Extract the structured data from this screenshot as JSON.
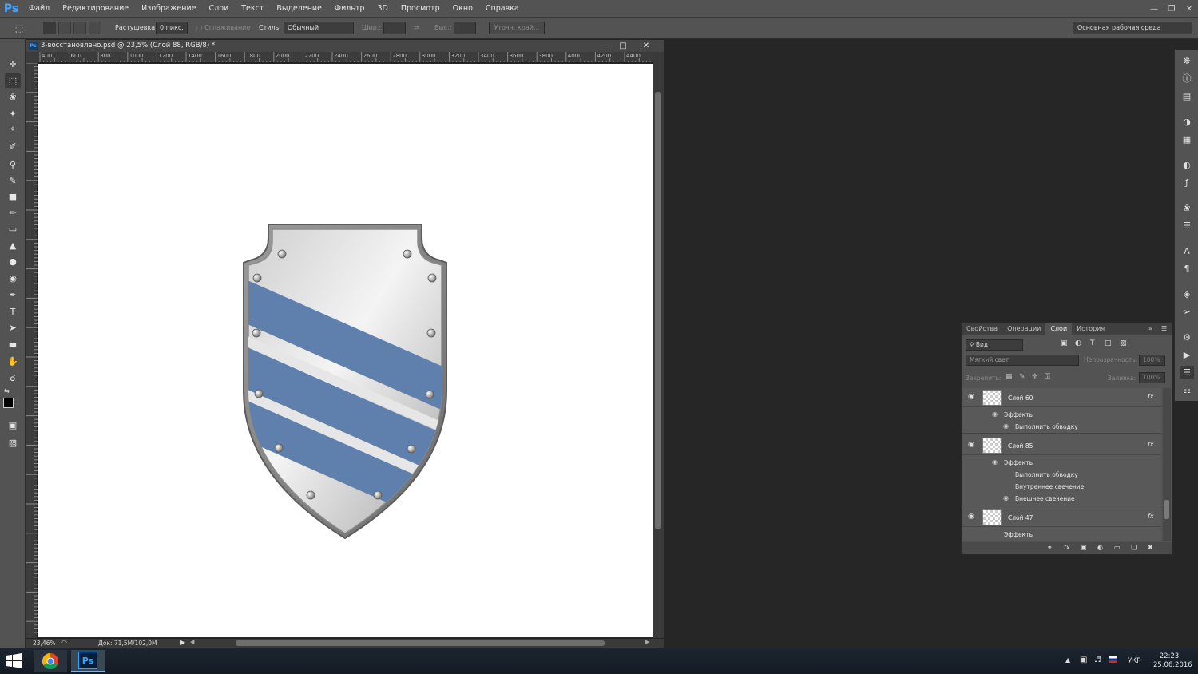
{
  "app": {
    "logo": "Ps"
  },
  "menu": [
    "Файл",
    "Редактирование",
    "Изображение",
    "Слои",
    "Текст",
    "Выделение",
    "Фильтр",
    "3D",
    "Просмотр",
    "Окно",
    "Справка"
  ],
  "options": {
    "feather_label": "Растушевка:",
    "feather_value": "0 пикс.",
    "antialias_label": "Сглаживание",
    "style_label": "Стиль:",
    "style_value": "Обычный",
    "width_label": "Шир.:",
    "height_label": "Выс.:",
    "refine_button": "Уточн. край..."
  },
  "workspace": "Основная рабочая среда",
  "document": {
    "title": "3-восстановлено.psd @ 23,5% (Слой 88, RGB/8) *",
    "zoom": "23,46%",
    "doc_info": "Док: 71,5M/102,0M",
    "ruler_labels": [
      "400",
      "600",
      "800",
      "1000",
      "1200",
      "1400",
      "1600",
      "1800",
      "2000",
      "2200",
      "2400",
      "2600",
      "2800",
      "3000",
      "3200",
      "3400",
      "3600",
      "3800",
      "4000",
      "4200",
      "4400"
    ]
  },
  "layers_panel": {
    "tabs": [
      "Свойства",
      "Операции",
      "Слои",
      "История"
    ],
    "active_tab": 2,
    "filter": "Вид",
    "blend_mode": "Мягкий свет",
    "opacity_label": "Непрозрачность:",
    "opacity_value": "100%",
    "lock_label": "Закрепить:",
    "fill_label": "Заливка:",
    "fill_value": "100%",
    "layers": [
      {
        "name": "Слой 60",
        "effects_label": "Эффекты",
        "effects": [
          "Выполнить обводку"
        ]
      },
      {
        "name": "Слой 85",
        "effects_label": "Эффекты",
        "effects": [
          "Выполнить обводку",
          "Внутреннее свечение",
          "Внешнее свечение"
        ]
      },
      {
        "name": "Слой 47",
        "effects_label": "Эффекты",
        "effects": []
      }
    ]
  },
  "taskbar": {
    "lang": "УКР",
    "time": "22:23",
    "date": "25.06.2016"
  },
  "colors": {
    "shield_band": "#5f7fac",
    "ps_blue": "#31a8ff"
  }
}
